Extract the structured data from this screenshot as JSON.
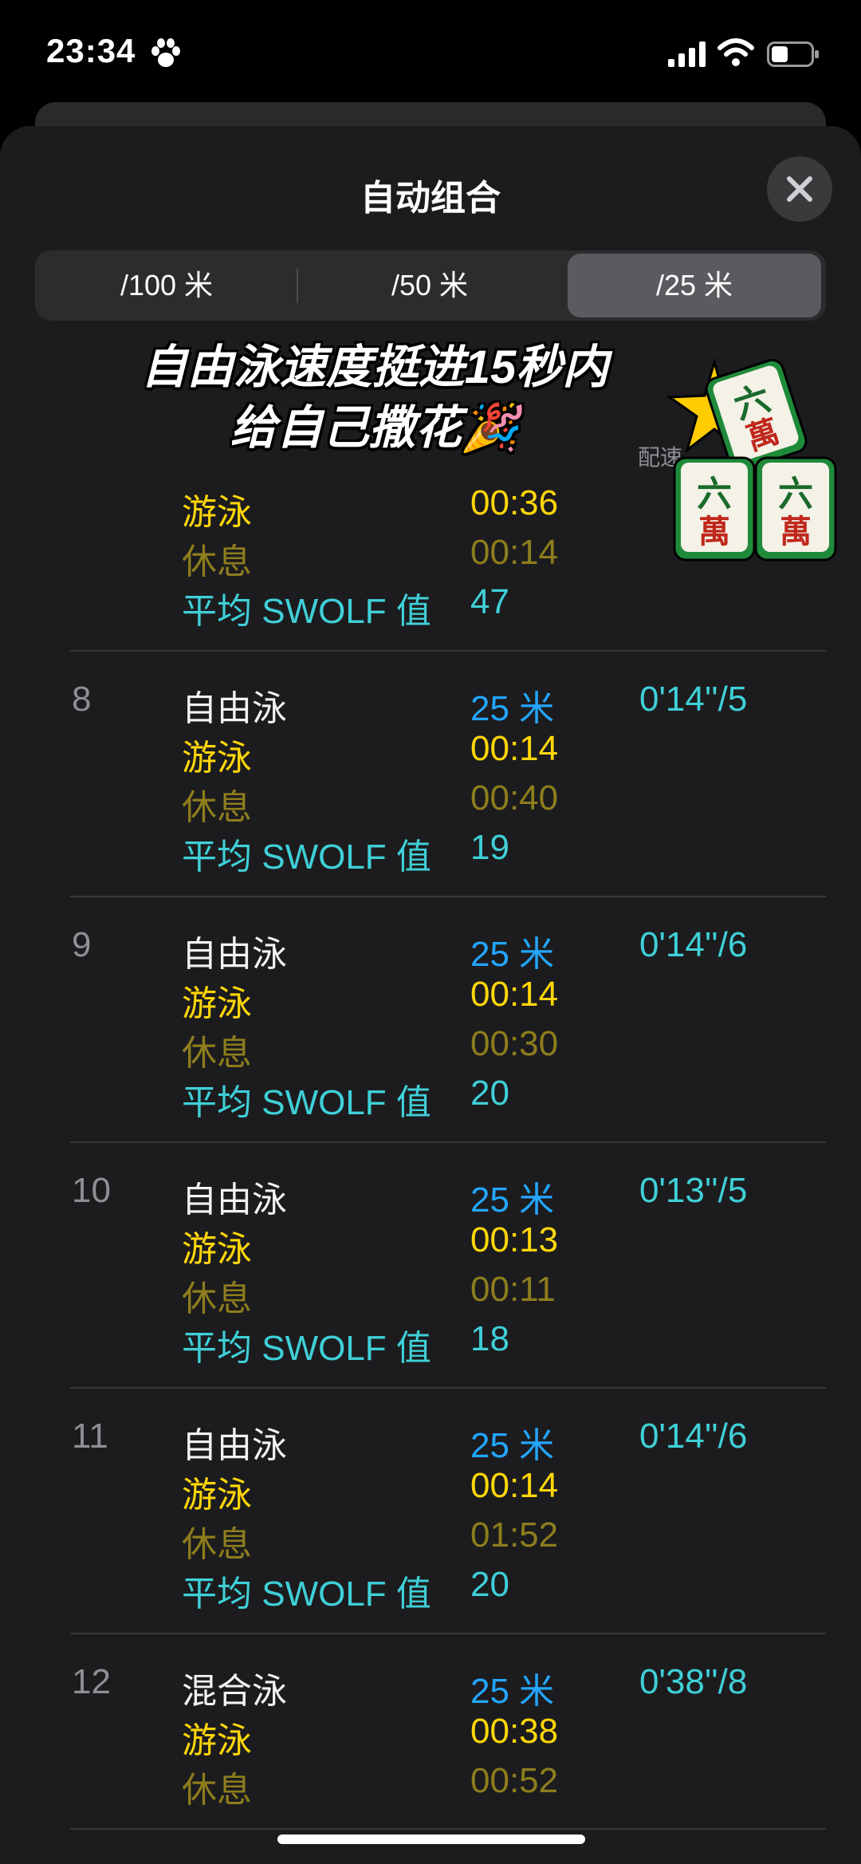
{
  "status": {
    "time": "23:34"
  },
  "sheet": {
    "title": "自动组合",
    "segments": [
      "/100 米",
      "/50 米",
      "/25 米"
    ],
    "selected_segment": "/25 米",
    "pace_header": "配速"
  },
  "overlay": {
    "line1": "自由泳速度挺进15秒内",
    "line2": "给自己撒花🎉",
    "sticker": "六六六 mahjong sticker with star"
  },
  "partial_set": {
    "swim_label": "游泳",
    "swim_value": "00:36",
    "rest_label": "休息",
    "rest_value": "00:14",
    "swolf_label": "平均 SWOLF 值",
    "swolf_value": "47"
  },
  "sets": [
    {
      "index": "8",
      "stroke": "自由泳",
      "distance": "25 米",
      "pace": "0'14''/5",
      "swim_label": "游泳",
      "swim": "00:14",
      "rest_label": "休息",
      "rest": "00:40",
      "swolf_label": "平均 SWOLF 值",
      "swolf": "19"
    },
    {
      "index": "9",
      "stroke": "自由泳",
      "distance": "25 米",
      "pace": "0'14''/6",
      "swim_label": "游泳",
      "swim": "00:14",
      "rest_label": "休息",
      "rest": "00:30",
      "swolf_label": "平均 SWOLF 值",
      "swolf": "20"
    },
    {
      "index": "10",
      "stroke": "自由泳",
      "distance": "25 米",
      "pace": "0'13''/5",
      "swim_label": "游泳",
      "swim": "00:13",
      "rest_label": "休息",
      "rest": "00:11",
      "swolf_label": "平均 SWOLF 值",
      "swolf": "18"
    },
    {
      "index": "11",
      "stroke": "自由泳",
      "distance": "25 米",
      "pace": "0'14''/6",
      "swim_label": "游泳",
      "swim": "00:14",
      "rest_label": "休息",
      "rest": "01:52",
      "swolf_label": "平均 SWOLF 值",
      "swolf": "20"
    },
    {
      "index": "12",
      "stroke": "混合泳",
      "distance": "25 米",
      "pace": "0'38''/8",
      "swim_label": "游泳",
      "swim": "00:38",
      "rest_label": "休息",
      "rest": "00:52"
    }
  ],
  "colors": {
    "background": "#1c1c1e",
    "label_swim": "#ffd60a",
    "label_rest": "#8d7d1d",
    "label_swolf": "#3fd0d8",
    "distance": "#23a6ff"
  }
}
